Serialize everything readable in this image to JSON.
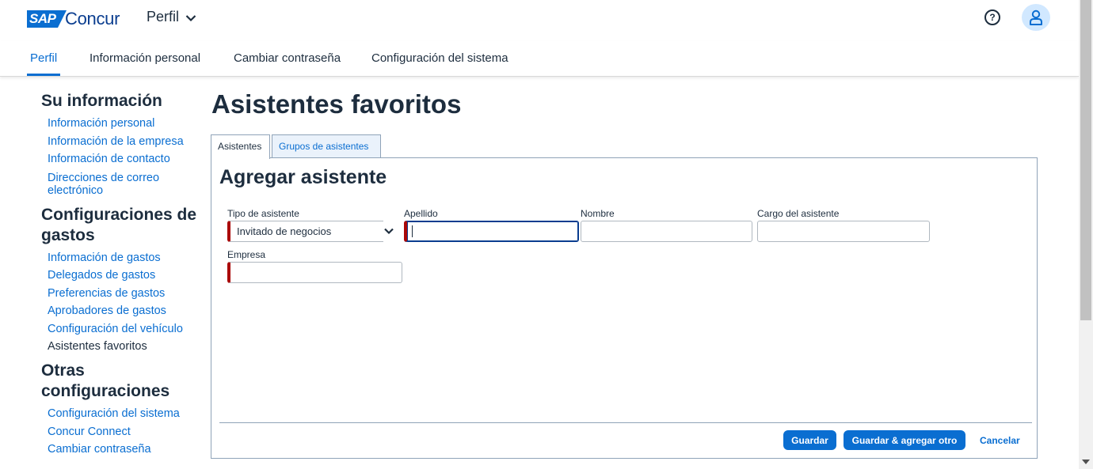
{
  "header": {
    "logo_mark": "SAP",
    "logo_name": "Concur",
    "menu_label": "Perfil",
    "help_icon": "question-circle-icon",
    "avatar_icon": "user-icon"
  },
  "nav": {
    "tabs": [
      {
        "label": "Perfil"
      },
      {
        "label": "Información personal"
      },
      {
        "label": "Cambiar contraseña"
      },
      {
        "label": "Configuración del sistema"
      }
    ]
  },
  "sidebar": {
    "sections": [
      {
        "title": "Su información",
        "items": [
          {
            "label": "Información personal"
          },
          {
            "label": "Información de la empresa"
          },
          {
            "label": "Información de contacto"
          },
          {
            "label": "Direcciones de correo electrónico"
          }
        ]
      },
      {
        "title": "Configuraciones de gastos",
        "items": [
          {
            "label": "Información de gastos"
          },
          {
            "label": "Delegados de gastos"
          },
          {
            "label": "Preferencias de gastos"
          },
          {
            "label": "Aprobadores de gastos"
          },
          {
            "label": "Configuración del vehículo"
          },
          {
            "label": "Asistentes favoritos"
          }
        ]
      },
      {
        "title": "Otras configuraciones",
        "items": [
          {
            "label": "Configuración del sistema"
          },
          {
            "label": "Concur Connect"
          },
          {
            "label": "Cambiar contraseña"
          }
        ]
      }
    ]
  },
  "main": {
    "title": "Asistentes favoritos",
    "tabs": [
      {
        "label": "Asistentes"
      },
      {
        "label": "Grupos de asistentes"
      }
    ],
    "form": {
      "title": "Agregar asistente",
      "attendee_type_label": "Tipo de asistente",
      "attendee_type_value": "Invitado de negocios",
      "last_name_label": "Apellido",
      "last_name_value": "",
      "first_name_label": "Nombre",
      "first_name_value": "",
      "job_title_label": "Cargo del asistente",
      "job_title_value": "",
      "company_label": "Empresa",
      "company_value": ""
    },
    "actions": {
      "save": "Guardar",
      "save_add": "Guardar & agregar otro",
      "cancel": "Cancelar"
    }
  },
  "colors": {
    "accent": "#0a6ed1",
    "required": "#aa0808",
    "text": "#1d2d3e"
  }
}
